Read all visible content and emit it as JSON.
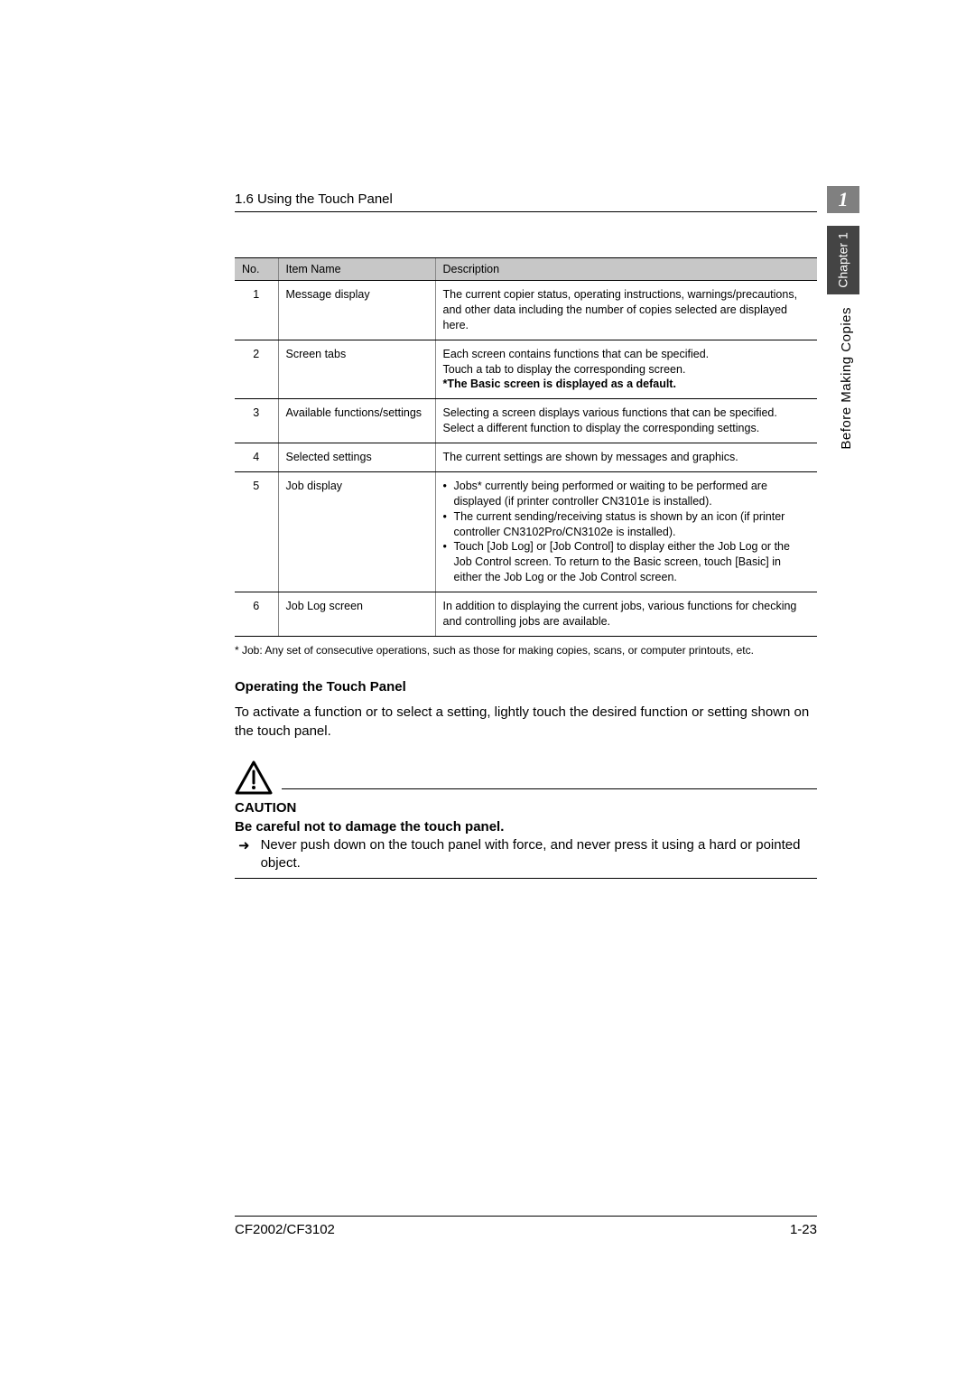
{
  "header": {
    "section_title": "1.6 Using the Touch Panel"
  },
  "page_badge": {
    "number": "1"
  },
  "side": {
    "chapter": "Chapter 1",
    "label": "Before Making Copies"
  },
  "table": {
    "headers": {
      "no": "No.",
      "name": "Item Name",
      "desc": "Description"
    },
    "rows": [
      {
        "no": "1",
        "name": "Message display",
        "desc": "The current copier status, operating instructions, warnings/precautions, and other data including the number of copies selected are displayed here."
      },
      {
        "no": "2",
        "name": "Screen tabs",
        "desc_line1": "Each screen contains functions that can be specified.",
        "desc_line2": "Touch a tab to display the corresponding screen.",
        "desc_bold": "*The Basic screen is displayed as a default."
      },
      {
        "no": "3",
        "name": "Available functions/settings",
        "desc_line1": "Selecting a screen displays various functions that can be specified.",
        "desc_line2": "Select a different function to display the corresponding settings."
      },
      {
        "no": "4",
        "name": "Selected settings",
        "desc": "The current settings are shown by messages and graphics."
      },
      {
        "no": "5",
        "name": "Job display",
        "bullets": [
          "Jobs* currently being performed or waiting to be performed are displayed (if printer controller CN3101e is installed).",
          "The current sending/receiving status is shown by an icon (if printer controller CN3102Pro/CN3102e is installed).",
          "Touch [Job Log] or [Job Control] to display either the Job Log or the Job Control screen. To return to the Basic screen, touch [Basic] in either the Job Log or the Job Control screen."
        ]
      },
      {
        "no": "6",
        "name": "Job Log screen",
        "desc": "In addition to displaying the current jobs, various functions for checking and controlling jobs are available."
      }
    ]
  },
  "footnote": "*   Job: Any set of consecutive operations, such as those for making copies, scans, or computer printouts, etc.",
  "section": {
    "heading": "Operating the Touch Panel",
    "body": "To activate a function or to select a setting, lightly touch the desired function or setting shown on the touch panel."
  },
  "caution": {
    "title": "CAUTION",
    "subtitle": "Be careful not to damage the touch panel.",
    "arrow": "➜",
    "item": "Never push down on the touch panel with force, and never press it using a hard or pointed object."
  },
  "footer": {
    "left": "CF2002/CF3102",
    "right": "1-23"
  }
}
